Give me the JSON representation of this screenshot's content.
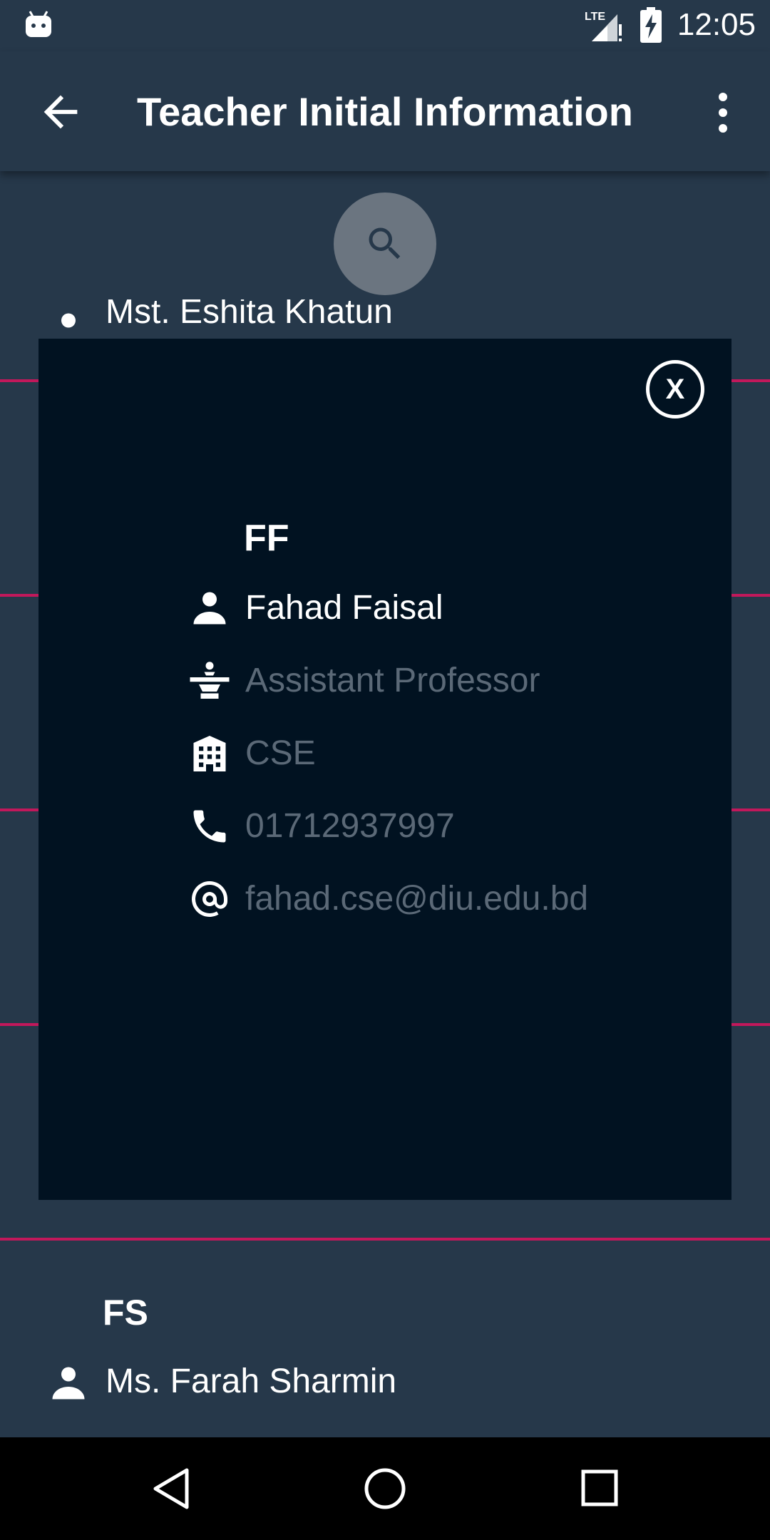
{
  "status_bar": {
    "time": "12:05",
    "network_label": "LTE",
    "icons": [
      "android-icon",
      "lte-signal-icon",
      "battery-charging-icon"
    ]
  },
  "app_bar": {
    "title": "Teacher Initial Information",
    "back_icon": "back-arrow-icon",
    "menu_icon": "more-vert-icon"
  },
  "search": {
    "icon": "search-icon"
  },
  "background_list": {
    "partial_item_name": "Mst. Eshita Khatun",
    "item_fs": {
      "initials": "FS",
      "name": "Ms. Farah Sharmin"
    }
  },
  "dialog": {
    "close_label": "X",
    "initials": "FF",
    "name": "Fahad Faisal",
    "designation": "Assistant Professor",
    "department": "CSE",
    "phone": "01712937997",
    "email": "fahad.cse@diu.edu.bd"
  },
  "nav_bar": {
    "icons": [
      "back-triangle-icon",
      "home-circle-icon",
      "recents-square-icon"
    ]
  },
  "colors": {
    "background": "#26384a",
    "dialog": "#011221",
    "divider": "#c2185b",
    "muted_text": "#5b6977",
    "fab": "#6b7580"
  }
}
